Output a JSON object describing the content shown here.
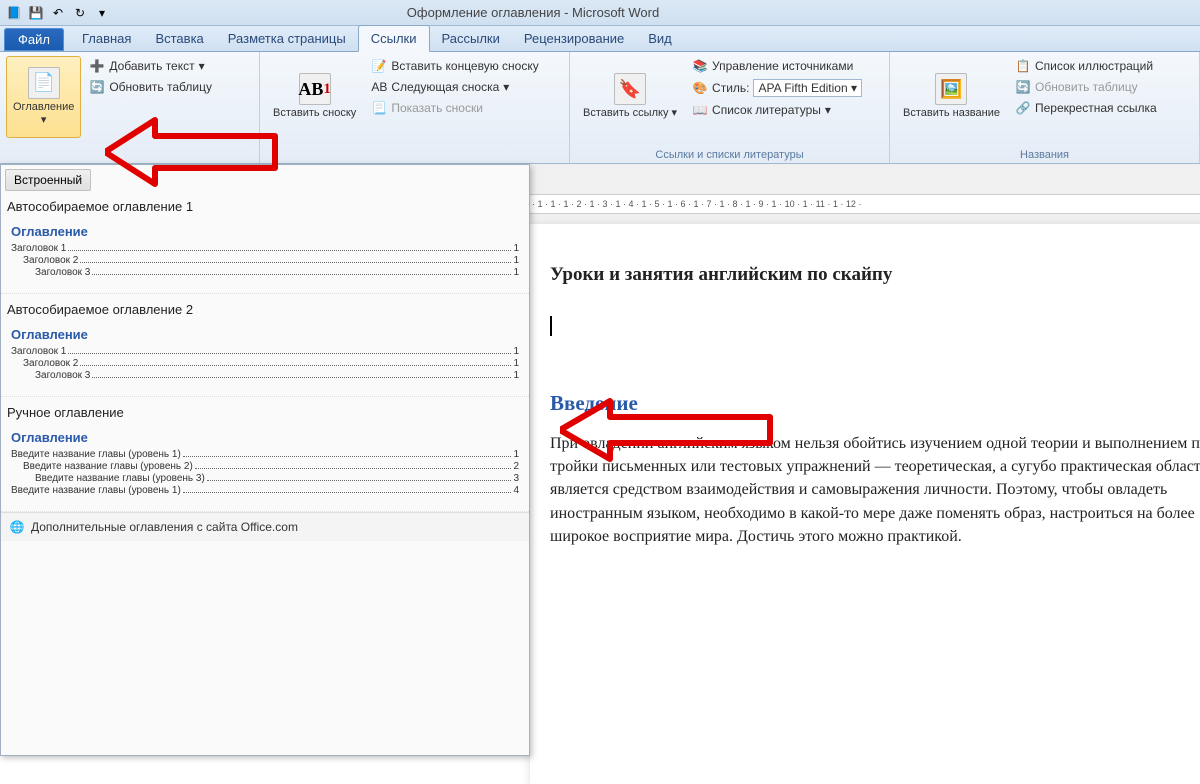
{
  "window": {
    "title": "Оформление оглавления - Microsoft Word"
  },
  "tabs": {
    "file": "Файл",
    "list": [
      "Главная",
      "Вставка",
      "Разметка страницы",
      "Ссылки",
      "Рассылки",
      "Рецензирование",
      "Вид"
    ],
    "active_index": 3
  },
  "ribbon": {
    "toc": {
      "big_label": "Оглавление",
      "add_text": "Добавить текст",
      "update": "Обновить таблицу"
    },
    "footnotes": {
      "big_label": "Вставить сноску",
      "ab_icon": "AB",
      "insert_end": "Вставить концевую сноску",
      "next": "Следующая сноска",
      "show": "Показать сноски"
    },
    "citations": {
      "big_label": "Вставить ссылку",
      "manage": "Управление источниками",
      "style_label": "Стиль:",
      "style_value": "APA Fifth Edition",
      "bibliography": "Список литературы",
      "group_title": "Ссылки и списки литературы"
    },
    "captions": {
      "big_label": "Вставить название",
      "list_figs": "Список иллюстраций",
      "update": "Обновить таблицу",
      "crossref": "Перекрестная ссылка",
      "group_title": "Названия"
    }
  },
  "gallery": {
    "header": "Встроенный",
    "options": [
      {
        "title": "Автособираемое оглавление 1",
        "preview_title": "Оглавление",
        "lines": [
          {
            "label": "Заголовок 1",
            "page": "1",
            "indent": 0
          },
          {
            "label": "Заголовок 2",
            "page": "1",
            "indent": 1
          },
          {
            "label": "Заголовок 3",
            "page": "1",
            "indent": 2
          }
        ]
      },
      {
        "title": "Автособираемое оглавление 2",
        "preview_title": "Оглавление",
        "lines": [
          {
            "label": "Заголовок 1",
            "page": "1",
            "indent": 0
          },
          {
            "label": "Заголовок 2",
            "page": "1",
            "indent": 1
          },
          {
            "label": "Заголовок 3",
            "page": "1",
            "indent": 2
          }
        ]
      },
      {
        "title": "Ручное оглавление",
        "preview_title": "Оглавление",
        "lines": [
          {
            "label": "Введите название главы (уровень 1)",
            "page": "1",
            "indent": 0
          },
          {
            "label": "Введите название главы (уровень 2)",
            "page": "2",
            "indent": 1
          },
          {
            "label": "Введите название главы (уровень 3)",
            "page": "3",
            "indent": 2
          },
          {
            "label": "Введите название главы (уровень 1)",
            "page": "4",
            "indent": 0
          }
        ]
      }
    ],
    "footer": "Дополнительные оглавления с сайта Office.com"
  },
  "ruler": "· 1 · 1 · 1 · 2 · 1 · 3 · 1 · 4 · 1 · 5 · 1 · 6 · 1 · 7 · 1 · 8 · 1 · 9 · 1 · 10 · 1 · 11 · 1 · 12 ·",
  "document": {
    "title": "Уроки и занятия английским по скайпу",
    "heading": "Введение",
    "body": "При овладении английским языком нельзя обойтись изучением одной теории и выполнением пары-тройки письменных или тестовых упражнений — теоретическая, а сугубо практическая область, он является средством взаимодействия и самовыражения личности. Поэтому, чтобы овладеть иностранным языком, необходимо в какой-то мере даже поменять образ, настроиться на более широкое восприятие мира. Достичь этого можно практикой."
  }
}
